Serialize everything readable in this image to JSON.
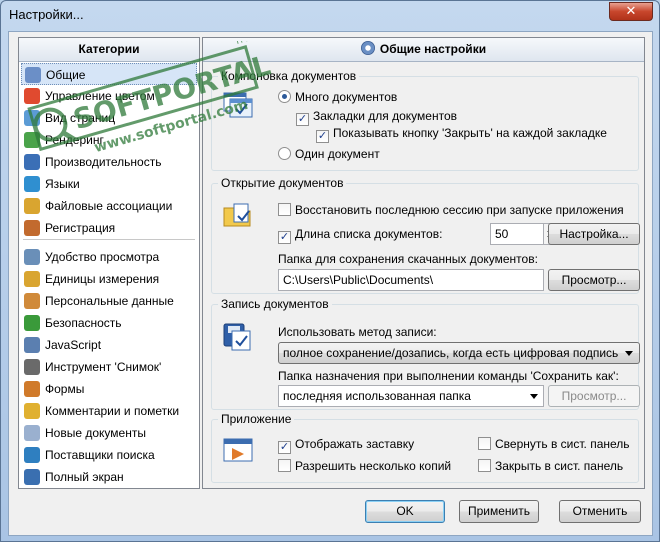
{
  "window": {
    "title": "Настройки...",
    "close_glyph": "✕"
  },
  "sidebar": {
    "header": "Категории",
    "items": [
      {
        "label": "Общие",
        "icon": "gear-icon",
        "color": "#6b8fc7",
        "selected": true
      },
      {
        "label": "Управление цветом",
        "icon": "color-palette-icon",
        "color": "#e04a2f"
      },
      {
        "label": "Вид страниц",
        "icon": "page-view-icon",
        "color": "#5b9bd5"
      },
      {
        "label": "Рендеринг",
        "icon": "rendering-icon",
        "color": "#4aa34a"
      },
      {
        "label": "Производительность",
        "icon": "performance-icon",
        "color": "#3b6fb6"
      },
      {
        "label": "Языки",
        "icon": "globe-icon",
        "color": "#2f8fd0"
      },
      {
        "label": "Файловые ассоциации",
        "icon": "file-association-icon",
        "color": "#d9a530"
      },
      {
        "label": "Регистрация",
        "icon": "registration-icon",
        "color": "#c26a2e"
      },
      {
        "label": "Удобство просмотра",
        "icon": "accessibility-icon",
        "color": "#6a8fb8"
      },
      {
        "label": "Единицы измерения",
        "icon": "ruler-icon",
        "color": "#d9a530"
      },
      {
        "label": "Персональные данные",
        "icon": "user-icon",
        "color": "#d08a3a"
      },
      {
        "label": "Безопасность",
        "icon": "shield-icon",
        "color": "#3a9a3a"
      },
      {
        "label": "JavaScript",
        "icon": "javascript-icon",
        "color": "#5b7fb0"
      },
      {
        "label": "Инструмент 'Снимок'",
        "icon": "camera-icon",
        "color": "#6a6a6a"
      },
      {
        "label": "Формы",
        "icon": "forms-icon",
        "color": "#d07a2a"
      },
      {
        "label": "Комментарии и пометки",
        "icon": "comments-icon",
        "color": "#e0b030"
      },
      {
        "label": "Новые документы",
        "icon": "new-document-icon",
        "color": "#9ab0cf"
      },
      {
        "label": "Поставщики поиска",
        "icon": "search-providers-icon",
        "color": "#2f7fc0"
      },
      {
        "label": "Полный экран",
        "icon": "fullscreen-icon",
        "color": "#3a6fb0"
      }
    ]
  },
  "main": {
    "header": "Общие настройки",
    "groups": {
      "compose": {
        "title": "Компоновка документов",
        "multi_docs": "Много документов",
        "tabs": "Закладки для документов",
        "close_button": "Показывать кнопку 'Закрыть' на каждой закладке",
        "single_doc": "Один документ"
      },
      "open": {
        "title": "Открытие документов",
        "restore_session": "Восстановить последнюю сессию при запуске приложения",
        "list_length": "Длина списка документов:",
        "list_length_value": "50",
        "settings_button": "Настройка...",
        "download_folder_label": "Папка для сохранения скачанных документов:",
        "download_folder_value": "C:\\Users\\Public\\Documents\\",
        "browse_button": "Просмотр..."
      },
      "save": {
        "title": "Запись документов",
        "method_label": "Использовать метод записи:",
        "method_value": "полное сохранение/дозапись, когда есть цифровая подпись",
        "save_as_label": "Папка назначения при выполнении команды 'Сохранить как':",
        "save_as_value": "последняя использованная папка",
        "browse_button": "Просмотр..."
      },
      "app": {
        "title": "Приложение",
        "splash": "Отображать заставку",
        "multiple_instances": "Разрешить несколько копий",
        "minimize_tray": "Свернуть в сист. панель",
        "close_tray": "Закрыть в сист. панель"
      }
    }
  },
  "footer": {
    "ok": "OK",
    "apply": "Применить",
    "cancel": "Отменить"
  },
  "checked_mark": "✓",
  "watermark": {
    "line1": "SOFTPORTAL",
    "line2": "www.softportal.com",
    "tm": "TM"
  }
}
